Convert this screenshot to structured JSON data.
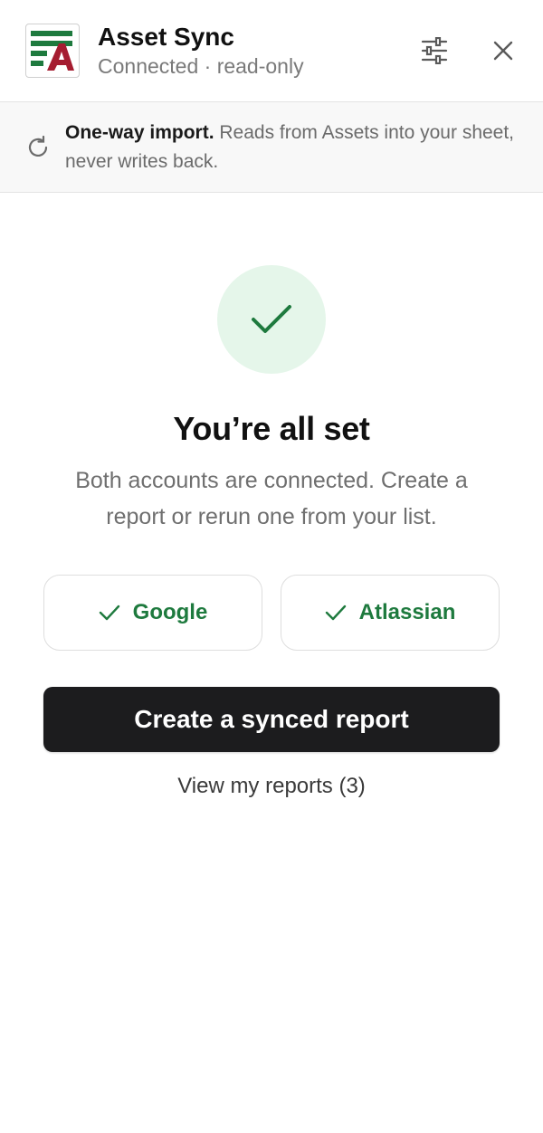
{
  "header": {
    "title": "Asset Sync",
    "status": "Connected · read-only",
    "logo_letter": "A",
    "settings_icon": "sliders-icon",
    "close_icon": "close-icon"
  },
  "banner": {
    "icon": "refresh-icon",
    "bold": "One-way import.",
    "text": " Reads from Assets into your sheet, never writes back."
  },
  "main": {
    "success_icon": "check-icon",
    "heading": "You’re all set",
    "subtext": "Both accounts are connected. Create a report or rerun one from your list.",
    "accounts": [
      {
        "label": "Google",
        "icon": "check-icon"
      },
      {
        "label": "Atlassian",
        "icon": "check-icon"
      }
    ],
    "primary_label": "Create a synced report",
    "secondary_label": "View my reports (3)"
  },
  "colors": {
    "brand_green": "#1e7a3e",
    "brand_red": "#a51c30",
    "success_bg": "#e5f6ea",
    "primary_button": "#1c1c1e"
  }
}
